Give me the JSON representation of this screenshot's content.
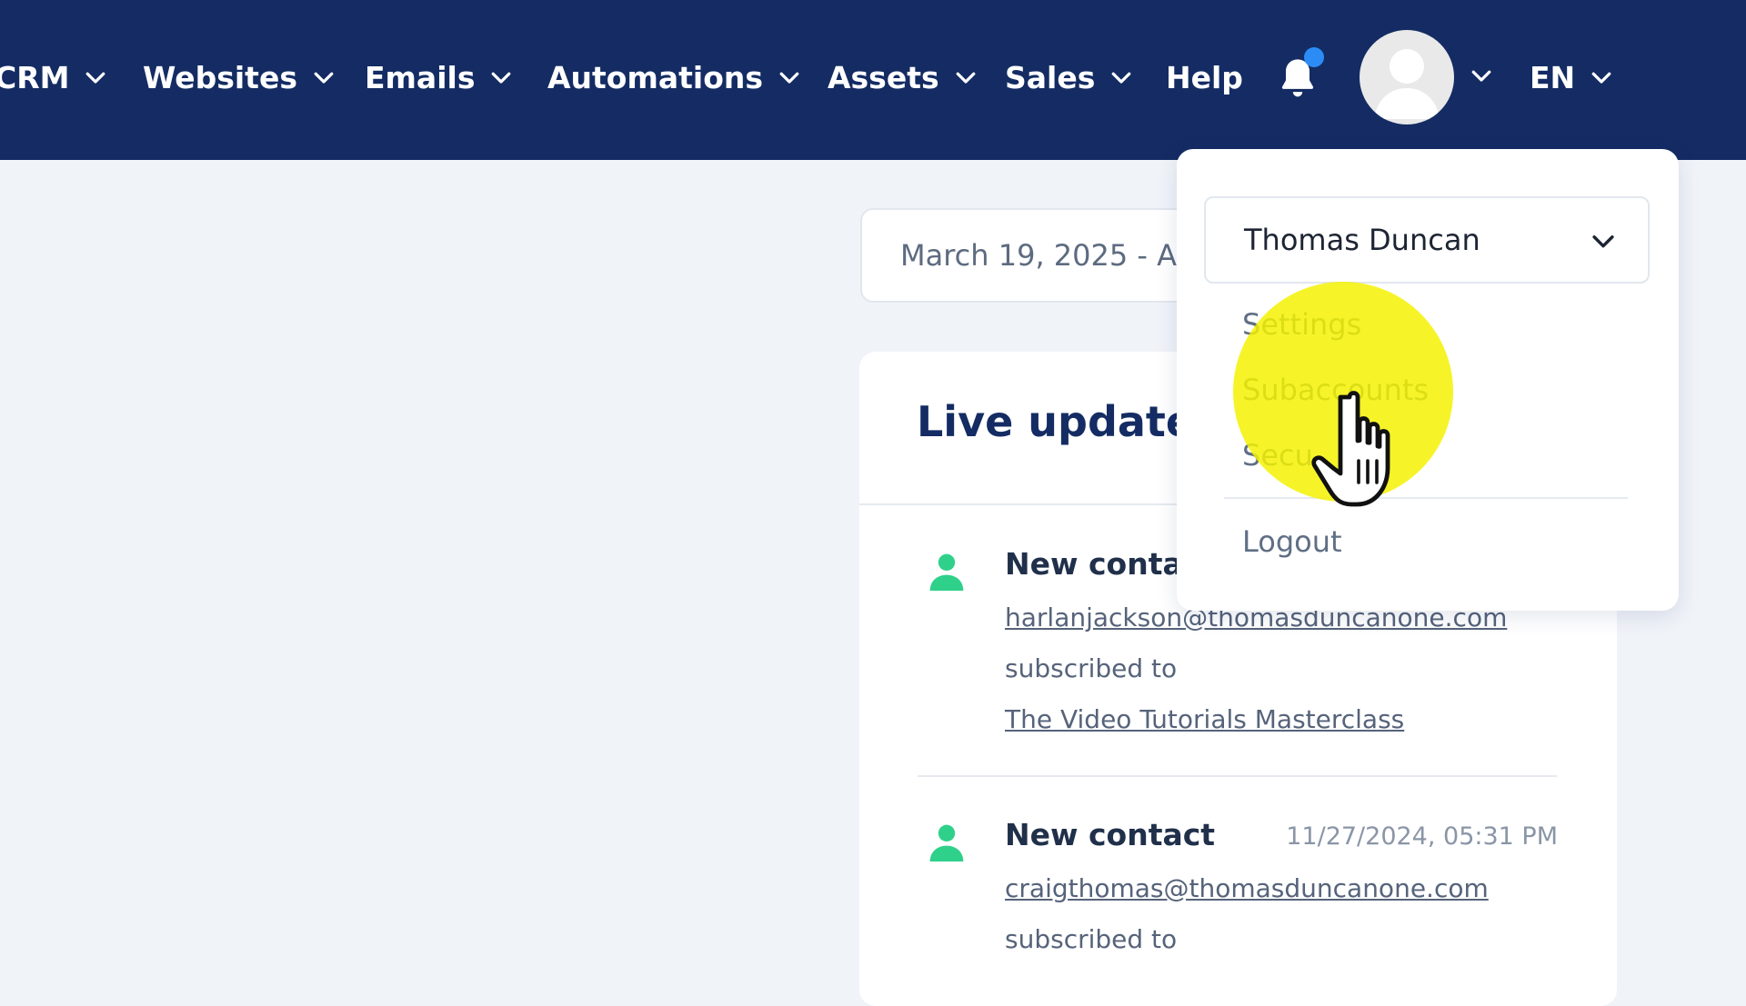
{
  "nav": {
    "items": [
      {
        "label": "CRM",
        "has_dropdown": true
      },
      {
        "label": "Websites",
        "has_dropdown": true
      },
      {
        "label": "Emails",
        "has_dropdown": true
      },
      {
        "label": "Automations",
        "has_dropdown": true
      },
      {
        "label": "Assets",
        "has_dropdown": true
      },
      {
        "label": "Sales",
        "has_dropdown": true
      },
      {
        "label": "Help",
        "has_dropdown": false
      }
    ],
    "language": "EN",
    "notification_icon": "bell-icon",
    "avatar_icon": "user-avatar-icon"
  },
  "date_range": {
    "value": "March 19, 2025 - Ap"
  },
  "live_updates": {
    "title": "Live update",
    "items": [
      {
        "heading": "New contac",
        "time": "",
        "email": "harlanjackson@thomasduncanone.com",
        "action": "subscribed to",
        "course": "The Video Tutorials Masterclass"
      },
      {
        "heading": "New contact",
        "time": "11/27/2024, 05:31 PM",
        "email": "craigthomas@thomasduncanone.com",
        "action": "subscribed to",
        "course": ""
      }
    ]
  },
  "user_menu": {
    "account_name": "Thomas Duncan",
    "items": [
      {
        "label": "Settings"
      },
      {
        "label": "Subaccounts"
      },
      {
        "label": "Secu"
      }
    ],
    "logout_label": "Logout"
  },
  "colors": {
    "nav_background": "#142c63",
    "page_background": "#f0f3f8",
    "contact_icon": "#2fd18a",
    "highlight": "#f4f200",
    "notification_dot": "#2b8cf6"
  }
}
